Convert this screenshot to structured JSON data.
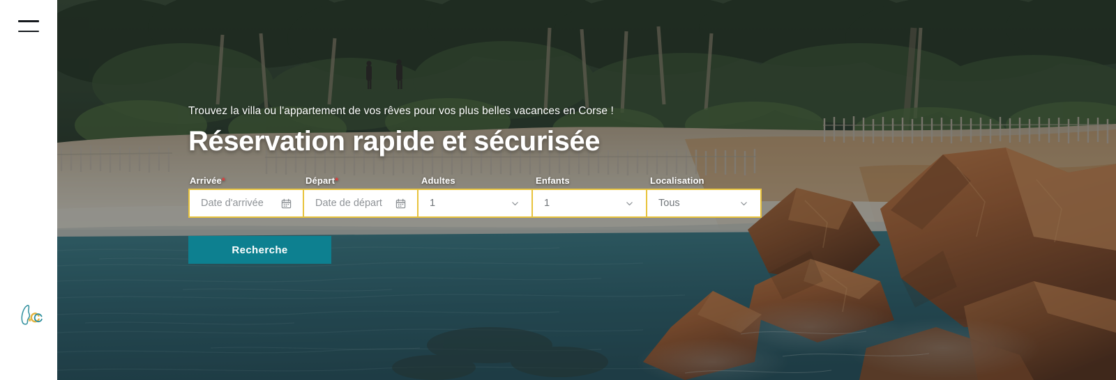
{
  "sidebar": {
    "menu_icon": "hamburger-menu-icon",
    "logo_icon": "corsica-island-logo-icon",
    "logo_colors": {
      "island": "#2f8f9d",
      "letter": "#e3b23c"
    }
  },
  "hero": {
    "kicker": "Trouvez la villa ou l'appartement de vos rêves pour vos plus belles vacances en Corse !",
    "headline": "Réservation rapide et sécurisée",
    "image_description": "Plage de Corse avec pins, sable clair, eau turquoise et rochers rouges"
  },
  "search_form": {
    "fields": [
      {
        "label": "Arrivée",
        "required": true,
        "required_marker": "*",
        "value": "",
        "placeholder": "Date d'arrivée",
        "type": "date",
        "icon": "calendar-icon"
      },
      {
        "label": "Départ",
        "required": true,
        "required_marker": "*",
        "value": "",
        "placeholder": "Date de départ",
        "type": "date",
        "icon": "calendar-icon"
      },
      {
        "label": "Adultes",
        "required": false,
        "required_marker": "",
        "value": "1",
        "placeholder": "",
        "type": "select",
        "icon": "chevron-down-icon"
      },
      {
        "label": "Enfants",
        "required": false,
        "required_marker": "",
        "value": "1",
        "placeholder": "",
        "type": "select",
        "icon": "chevron-down-icon"
      },
      {
        "label": "Localisation",
        "required": false,
        "required_marker": "",
        "value": "Tous",
        "placeholder": "",
        "type": "select",
        "icon": "chevron-down-icon"
      }
    ],
    "submit_label": "Recherche",
    "colors": {
      "border": "#e8c33c",
      "field_background": "#ffffff",
      "submit_background": "#0d8090",
      "required_marker": "#e03e3e"
    }
  }
}
